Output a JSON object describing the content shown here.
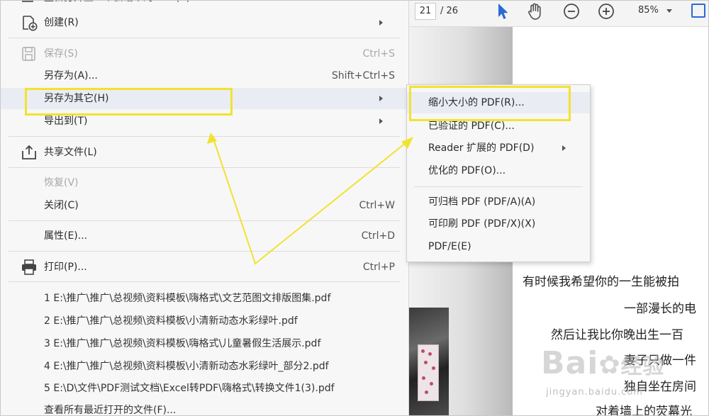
{
  "menu": {
    "top_partial": "重新打开上一个会话中的 PDF(B)",
    "items": [
      {
        "label": "创建(R)",
        "shortcut": "",
        "submenu": true,
        "disabled": false
      },
      {
        "label": "保存(S)",
        "shortcut": "Ctrl+S",
        "submenu": false,
        "disabled": true
      },
      {
        "label": "另存为(A)...",
        "shortcut": "Shift+Ctrl+S",
        "submenu": false,
        "disabled": false
      },
      {
        "label": "另存为其它(H)",
        "shortcut": "",
        "submenu": true,
        "disabled": false
      },
      {
        "label": "导出到(T)",
        "shortcut": "",
        "submenu": true,
        "disabled": false
      },
      {
        "label": "共享文件(L)",
        "shortcut": "",
        "submenu": false,
        "disabled": false
      },
      {
        "label": "恢复(V)",
        "shortcut": "",
        "submenu": false,
        "disabled": true
      },
      {
        "label": "关闭(C)",
        "shortcut": "Ctrl+W",
        "submenu": false,
        "disabled": false
      },
      {
        "label": "属性(E)...",
        "shortcut": "Ctrl+D",
        "submenu": false,
        "disabled": false
      },
      {
        "label": "打印(P)...",
        "shortcut": "Ctrl+P",
        "submenu": false,
        "disabled": false
      }
    ],
    "recent_files": [
      "1 E:\\推广\\推广\\总视频\\资料模板\\嗨格式\\文艺范图文排版图集.pdf",
      "2 E:\\推广\\推广\\总视频\\资料模板\\小清新动态水彩绿叶.pdf",
      "3 E:\\推广\\推广\\总视频\\资料模板\\嗨格式\\儿童暑假生活展示.pdf",
      "4 E:\\推广\\推广\\总视频\\资料模板\\小清新动态水彩绿叶_部分2.pdf",
      "5 E:\\D\\文件\\PDF测试文档\\Excel转PDF\\嗨格式\\转换文件1(3).pdf"
    ],
    "view_all_recent": "查看所有最近打开的文件(F)..."
  },
  "submenu": {
    "items": [
      {
        "label": "缩小大小的 PDF(R)...",
        "submenu": false
      },
      {
        "label": "已验证的 PDF(C)...",
        "submenu": false
      },
      {
        "label": "Reader 扩展的 PDF(D)",
        "submenu": true
      },
      {
        "label": "优化的 PDF(O)...",
        "submenu": false
      },
      {
        "label": "可归档 PDF (PDF/A)(A)",
        "submenu": false
      },
      {
        "label": "可印刷 PDF (PDF/X)(X)",
        "submenu": false
      },
      {
        "label": "PDF/E(E)",
        "submenu": false
      }
    ]
  },
  "toolbar": {
    "current_page": "21",
    "total_pages": "/ 26",
    "zoom": "85%",
    "icons": [
      "select-arrow-icon",
      "hand-tool-icon",
      "zoom-out-icon",
      "zoom-in-icon"
    ]
  },
  "document": {
    "lines": [
      "有时候我希望你的一生能被拍",
      "一部漫长的电",
      "然后让我比你晚出生一百",
      "妻子只做一件",
      "独自坐在房间",
      "对着墙上的荧幕光"
    ]
  },
  "watermark": {
    "brand": "Bai",
    "brand_cn": "经验",
    "url": "jingyan.baidu.com"
  },
  "colors": {
    "highlight": "#f2e230",
    "menu_bg": "#f7f7f7",
    "hover_bg": "#e9ecf3",
    "toolbar_blue": "#2a6ad5"
  }
}
